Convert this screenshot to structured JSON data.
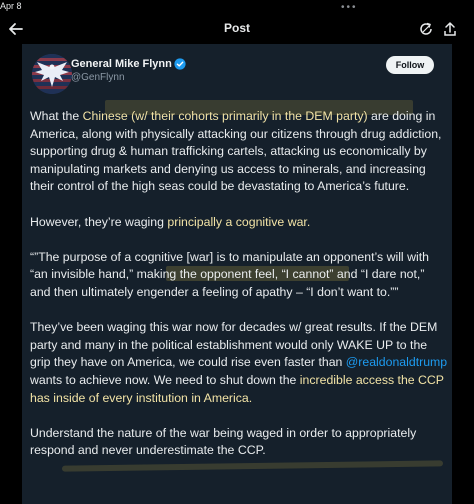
{
  "status_bar": {
    "time": "Apr 8",
    "more": "•••"
  },
  "header": {
    "title": "Post"
  },
  "author": {
    "display_name": "General Mike Flynn",
    "handle": "@GenFlynn"
  },
  "follow_label": "Follow",
  "post": {
    "p1": {
      "before": "What the ",
      "highlight": "Chinese (w/ their cohorts primarily in the DEM party) ",
      "after": "are doing in America, along with physically attacking our citizens through drug addiction, supporting drug & human trafficking cartels, attacking us economically by manipulating markets and denying us access to minerals, and increasing their control of the high seas could be devastating to America’s future."
    },
    "p2": {
      "before": "However, they’re waging ",
      "highlight": "principally a cognitive war."
    },
    "p3": "“”The purpose of a cognitive [war] is to manipulate an opponent’s will with “an invisible hand,” making the opponent feel, “I cannot” and “I dare not,” and then ultimately engender a feeling of apathy – “I don’t want to.””",
    "p4": {
      "before": "They’ve been waging this war now for decades w/ great results. If the DEM party and many in the political establishment would only WAKE UP to the grip they have on America, we could rise even faster than ",
      "mention": "@realdonaldtrump",
      "middle": " wants to achieve now. We need to shut down the ",
      "highlight": "incredible access the CCP has inside of every institution in America."
    },
    "p5": "Understand the nature of the war being waged in order to appropriately respond and never underestimate the CCP."
  }
}
